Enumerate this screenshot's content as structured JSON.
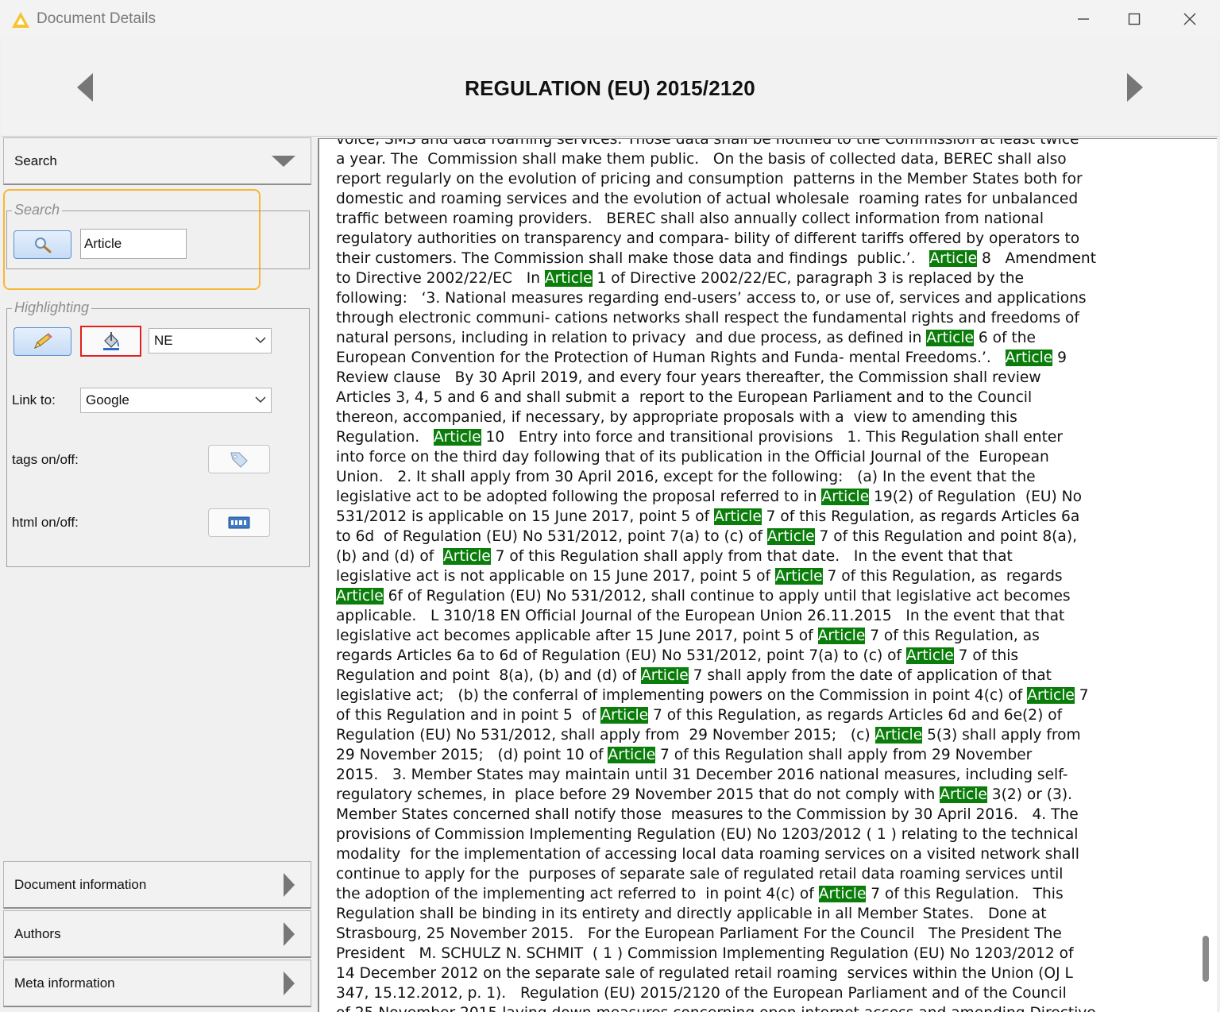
{
  "window": {
    "title": "Document Details",
    "icon": "knime-triangle-icon",
    "controls": [
      "minimize-icon",
      "maximize-icon",
      "close-icon"
    ]
  },
  "header": {
    "document_title": "REGULATION (EU) 2015/2120",
    "prev_icon": "triangle-left-icon",
    "next_icon": "triangle-right-icon"
  },
  "sidebar": {
    "search_section": {
      "label": "Search",
      "icon": "chevron-down-icon"
    },
    "search_group": {
      "legend": "Search",
      "button_icon": "magnifier-icon",
      "query": "Article"
    },
    "highlighting_group": {
      "legend": "Highlighting",
      "pencil_icon": "pencil-icon",
      "fill_icon": "paint-bucket-icon",
      "tagger_value": "NE",
      "link_label": "Link to:",
      "link_value": "Google",
      "tags_label": "tags on/off:",
      "tags_icon": "tag-icon",
      "html_label": "html on/off:",
      "html_icon": "html-icon"
    },
    "collapsed_sections": [
      {
        "label": "Document information",
        "icon": "chevron-right-icon"
      },
      {
        "label": "Authors",
        "icon": "chevron-right-icon"
      },
      {
        "label": "Meta information",
        "icon": "chevron-right-icon"
      }
    ]
  },
  "document": {
    "highlight_term": "Article",
    "highlight_color": "#0a7d0a",
    "lines": [
      "voice, SMS and data roaming services. Those data shall be notified to the Commission at least twice",
      "a year. The  Commission shall make them public.   On the basis of collected data, BEREC shall also",
      "report regularly on the evolution of pricing and consumption  patterns in the Member States both for",
      "domestic and roaming services and the evolution of actual wholesale  roaming rates for unbalanced",
      "traffic between roaming providers.   BEREC shall also annually collect information from national",
      "regulatory authorities on transparency and compara- bility of different tariffs offered by operators to",
      "their customers. The Commission shall make those data and findings  public.’.   Article 8   Amendment",
      "to Directive 2002/22/EC   In Article 1 of Directive 2002/22/EC, paragraph 3 is replaced by the",
      "following:   ‘3. National measures regarding end-users’ access to, or use of, services and applications",
      "through electronic communi- cations networks shall respect the fundamental rights and freedoms of",
      "natural persons, including in relation to privacy  and due process, as defined in Article 6 of the",
      "European Convention for the Protection of Human Rights and Funda- mental Freedoms.’.   Article 9",
      "Review clause   By 30 April 2019, and every four years thereafter, the Commission shall review",
      "Articles 3, 4, 5 and 6 and shall submit a  report to the European Parliament and to the Council",
      "thereon, accompanied, if necessary, by appropriate proposals with a  view to amending this",
      "Regulation.   Article 10   Entry into force and transitional provisions   1. This Regulation shall enter",
      "into force on the third day following that of its publication in the Official Journal of the  European",
      "Union.   2. It shall apply from 30 April 2016, except for the following:   (a) In the event that the",
      "legislative act to be adopted following the proposal referred to in Article 19(2) of Regulation  (EU) No",
      "531/2012 is applicable on 15 June 2017, point 5 of Article 7 of this Regulation, as regards Articles 6a",
      "to 6d  of Regulation (EU) No 531/2012, point 7(a) to (c) of Article 7 of this Regulation and point 8(a),",
      "(b) and (d) of  Article 7 of this Regulation shall apply from that date.   In the event that that",
      "legislative act is not applicable on 15 June 2017, point 5 of Article 7 of this Regulation, as  regards",
      "Article 6f of Regulation (EU) No 531/2012, shall continue to apply until that legislative act becomes",
      "applicable.   L 310/18 EN Official Journal of the European Union 26.11.2015   In the event that that",
      "legislative act becomes applicable after 15 June 2017, point 5 of Article 7 of this Regulation, as",
      "regards Articles 6a to 6d of Regulation (EU) No 531/2012, point 7(a) to (c) of Article 7 of this",
      "Regulation and point  8(a), (b) and (d) of Article 7 shall apply from the date of application of that",
      "legislative act;   (b) the conferral of implementing powers on the Commission in point 4(c) of Article 7",
      "of this Regulation and in point 5  of Article 7 of this Regulation, as regards Articles 6d and 6e(2) of",
      "Regulation (EU) No 531/2012, shall apply from  29 November 2015;   (c) Article 5(3) shall apply from",
      "29 November 2015;   (d) point 10 of Article 7 of this Regulation shall apply from 29 November",
      "2015.   3. Member States may maintain until 31 December 2016 national measures, including self-",
      "regulatory schemes, in  place before 29 November 2015 that do not comply with Article 3(2) or (3).",
      "Member States concerned shall notify those  measures to the Commission by 30 April 2016.   4. The",
      "provisions of Commission Implementing Regulation (EU) No 1203/2012 ( 1 ) relating to the technical",
      "modality  for the implementation of accessing local data roaming services on a visited network shall",
      "continue to apply for the  purposes of separate sale of regulated retail data roaming services until",
      "the adoption of the implementing act referred to  in point 4(c) of Article 7 of this Regulation.   This",
      "Regulation shall be binding in its entirety and directly applicable in all Member States.   Done at",
      "Strasbourg, 25 November 2015.   For the European Parliament For the Council   The President The",
      "President   M. SCHULZ N. SCHMIT  ( 1 ) Commission Implementing Regulation (EU) No 1203/2012 of",
      "14 December 2012 on the separate sale of regulated retail roaming  services within the Union (OJ L",
      "347, 15.12.2012, p. 1).   Regulation (EU) 2015/2120 of the European Parliament and of the Council",
      "of 25 November 2015 laying down measures concerning open internet access and amending Directive"
    ]
  }
}
